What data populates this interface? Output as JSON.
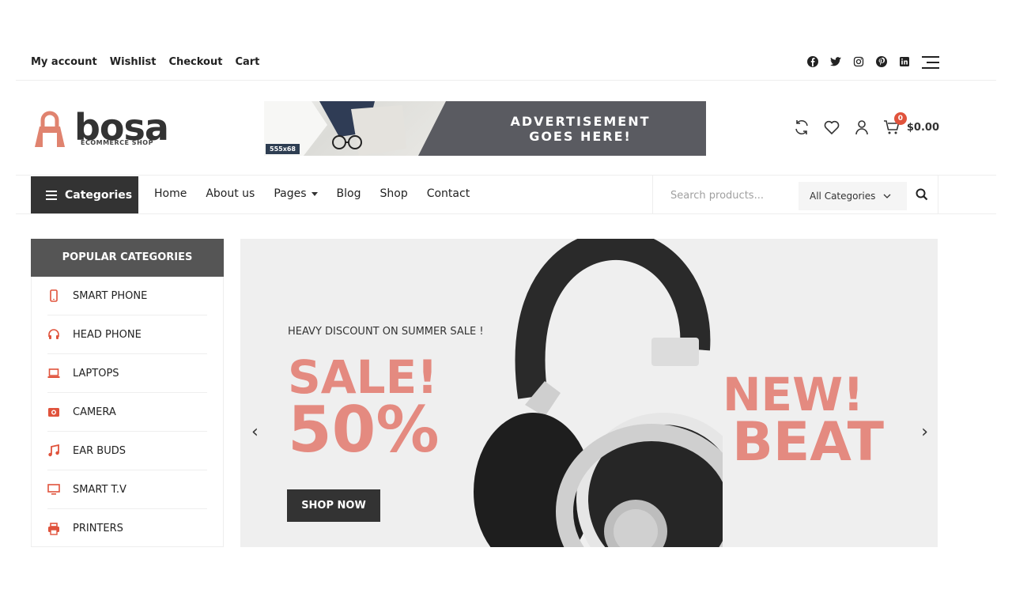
{
  "topbar": {
    "links": [
      "My account",
      "Wishlist",
      "Checkout",
      "Cart"
    ],
    "social_icons": [
      "facebook-icon",
      "twitter-icon",
      "instagram-icon",
      "pinterest-icon",
      "linkedin-icon"
    ]
  },
  "header": {
    "logo_text": "bosa",
    "logo_subtext": "ECOMMERCE SHOP",
    "ad": {
      "size_label": "555x68",
      "line1": "ADVERTISEMENT",
      "line2": "GOES HERE!"
    },
    "cart": {
      "count": "0",
      "total": "$0.00"
    },
    "accent_color": "#e0533c"
  },
  "nav": {
    "categories_label": "Categories",
    "menu": [
      "Home",
      "About us",
      "Pages",
      "Blog",
      "Shop",
      "Contact"
    ],
    "search_placeholder": "Search products...",
    "category_select": "All Categories"
  },
  "sidebar": {
    "title": "POPULAR CATEGORIES",
    "items": [
      {
        "label": "SMART PHONE",
        "icon": "smartphone-icon"
      },
      {
        "label": "HEAD PHONE",
        "icon": "headphone-icon"
      },
      {
        "label": "LAPTOPS",
        "icon": "laptop-icon"
      },
      {
        "label": "CAMERA",
        "icon": "camera-icon"
      },
      {
        "label": "EAR BUDS",
        "icon": "music-note-icon"
      },
      {
        "label": "SMART T.V",
        "icon": "tv-icon"
      },
      {
        "label": "PRINTERS",
        "icon": "printer-icon"
      }
    ]
  },
  "slider": {
    "subtitle": "HEAVY DISCOUNT ON SUMMER SALE !",
    "sale": "SALE!",
    "percent": "50%",
    "button": "SHOP NOW",
    "new": "NEW!",
    "beat": "BEAT",
    "highlight_color": "#e48a80"
  }
}
